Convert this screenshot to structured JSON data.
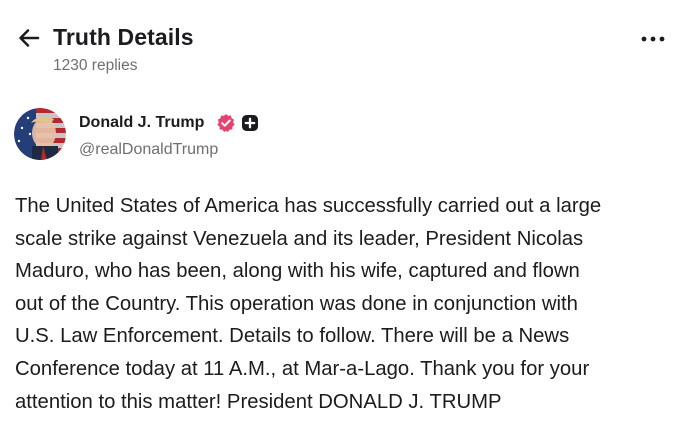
{
  "header": {
    "title": "Truth Details",
    "replies": "1230 replies",
    "back_icon": "arrow-left-icon",
    "more_icon": "more-horizontal-icon"
  },
  "author": {
    "name": "Donald J. Trump",
    "handle": "@realDonaldTrump",
    "verified_icon": "verified-check-icon",
    "verified_color": "#e64270",
    "plus_icon": "plus-badge-icon"
  },
  "post": {
    "lines": [
      "The United States of America has successfully carried out a large",
      "scale strike against Venezuela and its leader, President Nicolas",
      "Maduro, who has been, along with his wife, captured and flown",
      "out of the Country. This operation was done in conjunction with",
      "U.S. Law Enforcement. Details to follow. There will be a News",
      "Conference today at 11 A.M., at Mar-a-Lago. Thank you for your",
      "attention to this matter! President DONALD J. TRUMP"
    ]
  }
}
